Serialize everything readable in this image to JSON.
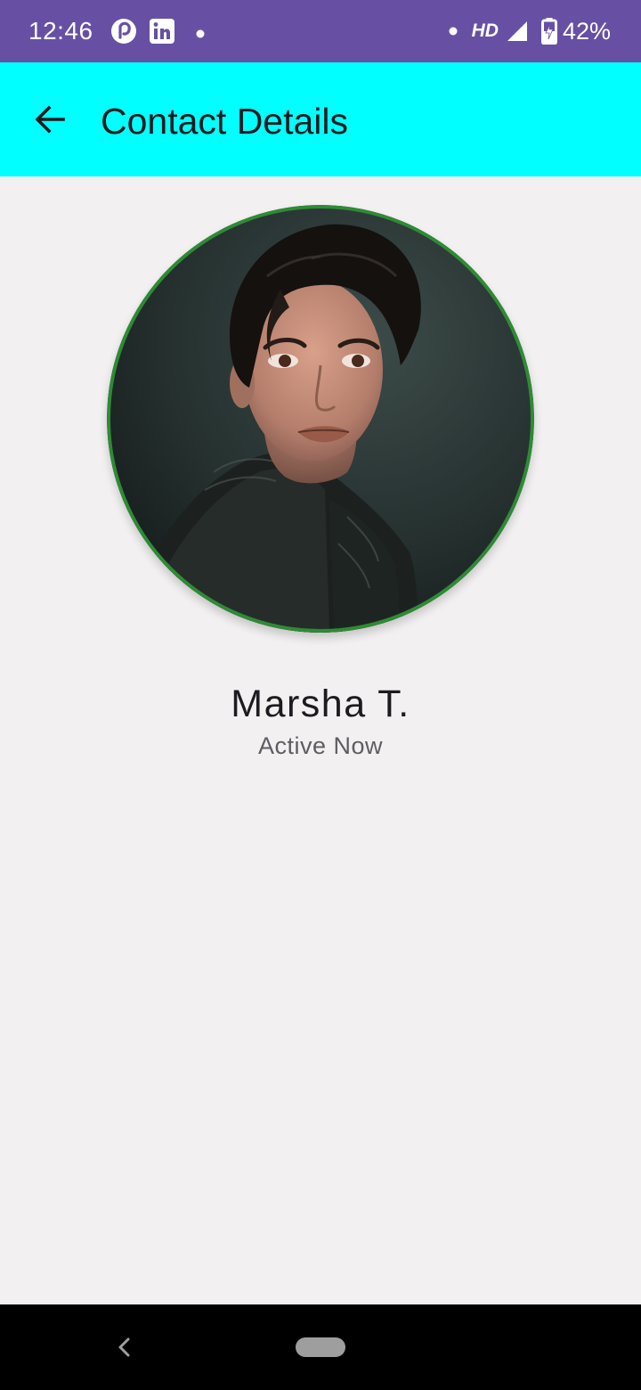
{
  "status_bar": {
    "time": "12:46",
    "network_label": "HD",
    "battery_percent": "42%",
    "background_color": "#6750a4",
    "icons": [
      "pocket-casts-icon",
      "linkedin-icon",
      "notification-dot-icon",
      "dot-icon",
      "signal-icon",
      "battery-charging-icon"
    ]
  },
  "app_bar": {
    "title": "Contact Details",
    "background_color": "#00ffff",
    "back_icon": "arrow-back-icon"
  },
  "contact": {
    "name": "Marsha T.",
    "status": "Active Now",
    "avatar_border_color": "#2e8b34"
  },
  "nav_bar": {
    "back_icon": "nav-back-chevron-icon",
    "home_icon": "home-pill-icon"
  }
}
